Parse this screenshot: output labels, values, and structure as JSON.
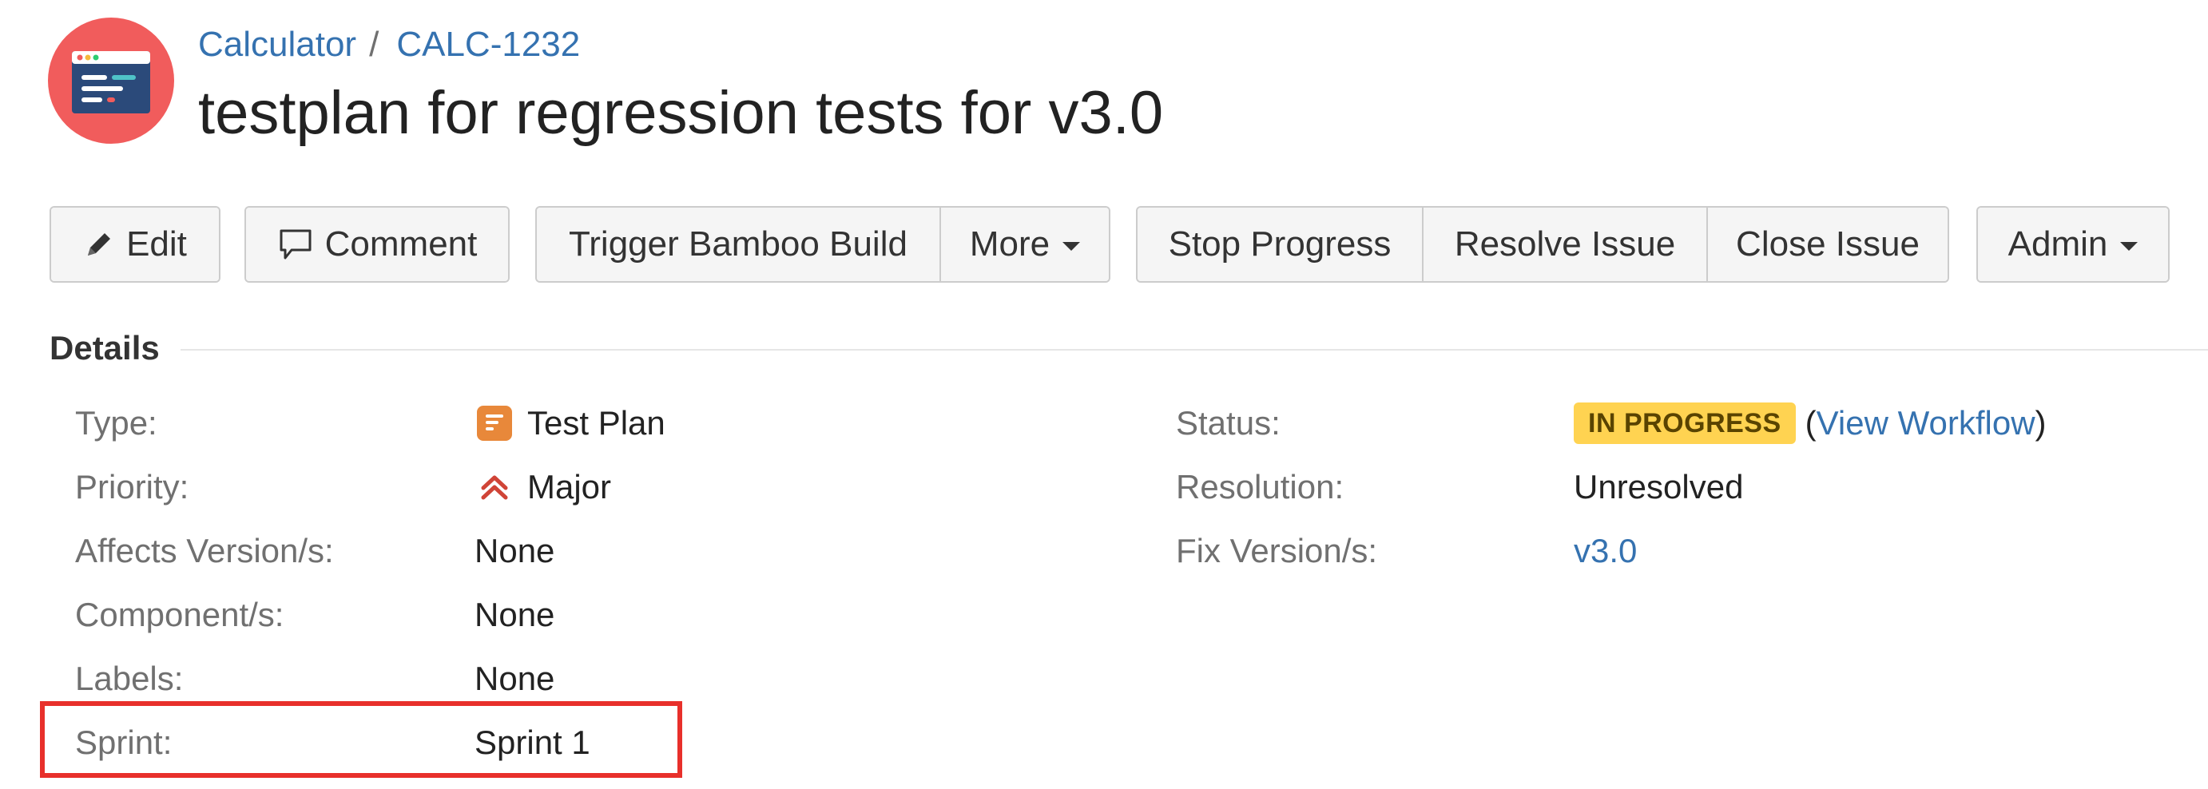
{
  "header": {
    "project_avatar_icon": "calculator-project-avatar-icon",
    "breadcrumb": {
      "project": "Calculator",
      "separator": "/",
      "issue_key": "CALC-1232"
    },
    "summary": "testplan for regression tests for v3.0"
  },
  "toolbar": {
    "edit_label": "Edit",
    "edit_icon": "pencil-icon",
    "comment_label": "Comment",
    "comment_icon": "speech-bubble-icon",
    "trigger_bamboo_label": "Trigger Bamboo Build",
    "more_label": "More",
    "stop_progress_label": "Stop Progress",
    "resolve_issue_label": "Resolve Issue",
    "close_issue_label": "Close Issue",
    "admin_label": "Admin"
  },
  "details": {
    "heading": "Details",
    "left_fields": {
      "type": {
        "label": "Type:",
        "value": "Test Plan",
        "icon": "test-plan-icon"
      },
      "priority": {
        "label": "Priority:",
        "value": "Major",
        "icon": "major-priority-icon"
      },
      "affects_versions": {
        "label": "Affects Version/s:",
        "value": "None"
      },
      "components": {
        "label": "Component/s:",
        "value": "None"
      },
      "labels": {
        "label": "Labels:",
        "value": "None"
      },
      "sprint": {
        "label": "Sprint:",
        "value": "Sprint 1"
      }
    },
    "right_fields": {
      "status": {
        "label": "Status:",
        "value": "IN PROGRESS",
        "paren_open": "(",
        "workflow_link": "View Workflow",
        "paren_close": ")"
      },
      "resolution": {
        "label": "Resolution:",
        "value": "Unresolved"
      },
      "fix_versions": {
        "label": "Fix Version/s:",
        "value": "v3.0"
      }
    }
  },
  "colors": {
    "link": "#3572b0",
    "status_lozenge": "#ffd351",
    "highlight_border": "#e8302b",
    "priority_major": "#d04437",
    "type_test_plan": "#e8883a"
  }
}
